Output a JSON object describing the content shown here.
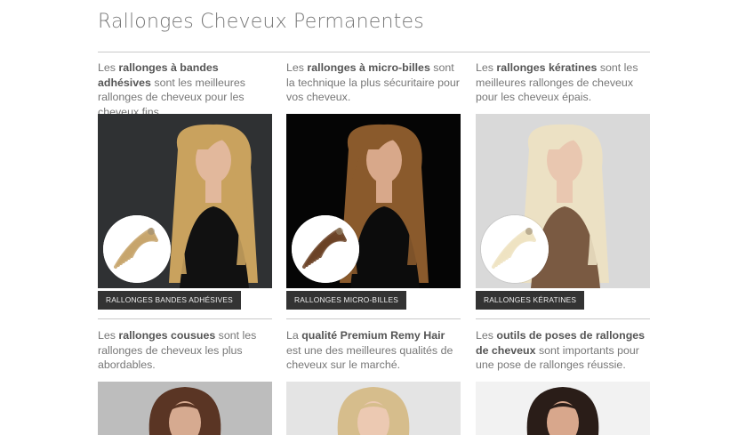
{
  "page": {
    "title": "Rallonges Cheveux Permanentes"
  },
  "row1": [
    {
      "pre": "Les ",
      "strong": "rallonges à bandes adhésives",
      "post": " sont les meilleures rallonges de cheveux pour les cheveux fins.",
      "button": "RALLONGES BANDES ADHÉSIVES",
      "colors": {
        "bg": "#2f3133",
        "hair": "#c9a25e",
        "skin": "#e2b89c",
        "dress": "#111111",
        "badge_hair": "#c7a56c"
      }
    },
    {
      "pre": "Les ",
      "strong": "rallonges à micro-billes",
      "post": " sont la technique la plus sécuritaire pour vos cheveux.",
      "button": "RALLONGES MICRO-BILLES",
      "colors": {
        "bg": "#050505",
        "hair": "#8a5a2c",
        "skin": "#d8a88a",
        "dress": "#0c0c0c",
        "badge_hair": "#6b4226"
      }
    },
    {
      "pre": "Les ",
      "strong": "rallonges kératines",
      "post": " sont les meilleures rallonges de cheveux pour les cheveux épais.",
      "button": "RALLONGES KÉRATINES",
      "colors": {
        "bg": "#d9d9d9",
        "hair": "#ece1c4",
        "skin": "#e9c7b0",
        "dress": "#7a5a42",
        "badge_hair": "#efe3c2"
      }
    }
  ],
  "row2": [
    {
      "pre": "Les ",
      "strong": "rallonges cousues",
      "post": " sont les rallonges de cheveux les plus abordables.",
      "colors": {
        "bg": "#bdbdbd",
        "hair": "#5a3524",
        "skin": "#d6aa90"
      }
    },
    {
      "pre": "La ",
      "strong": "qualité Premium Remy Hair",
      "post": " est une des meilleures qualités de cheveux sur le marché.",
      "colors": {
        "bg": "#e4e4e4",
        "hair": "#d6bd8c",
        "skin": "#ecc9b2"
      }
    },
    {
      "pre": "Les ",
      "strong": "outils de poses de rallonges de cheveux",
      "post": " sont importants pour une pose de rallonges réussie.",
      "colors": {
        "bg": "#f2f2f2",
        "hair": "#2a1d18",
        "skin": "#d8a78c"
      }
    }
  ]
}
